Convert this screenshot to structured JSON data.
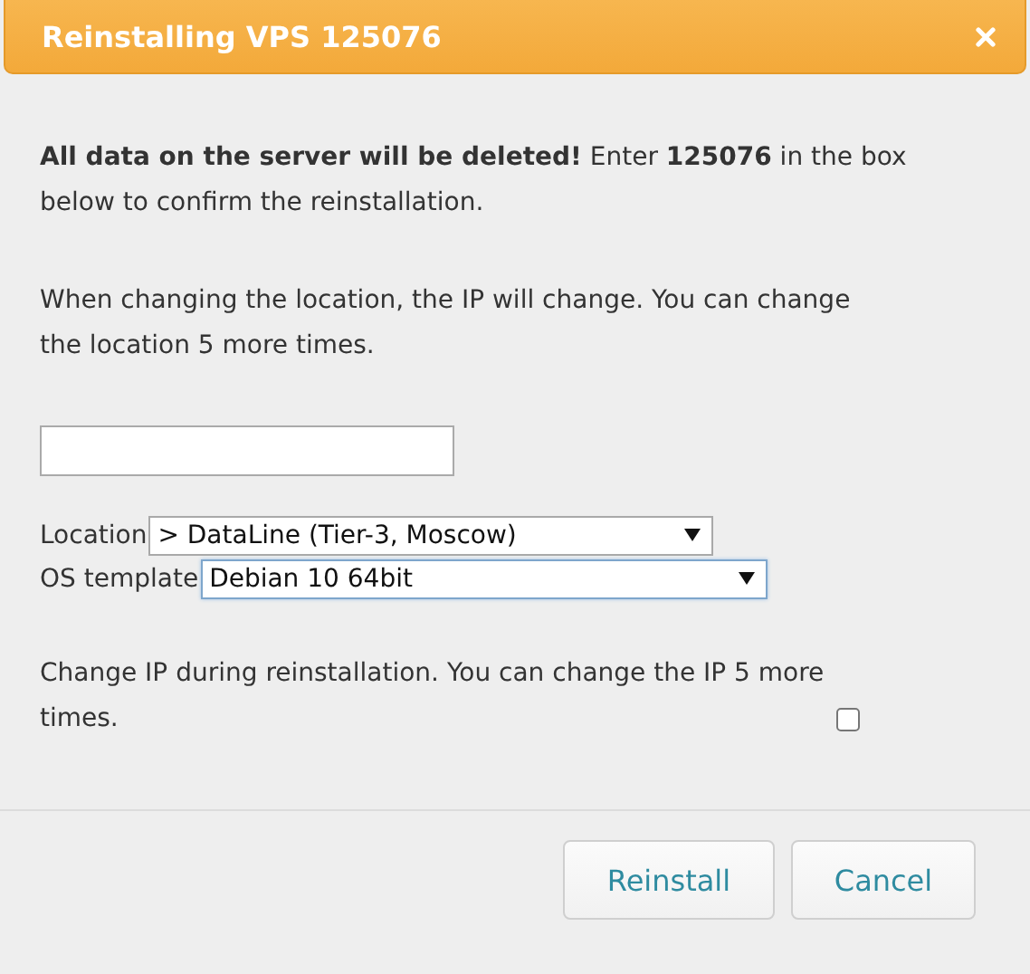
{
  "dialog": {
    "title": "Reinstalling VPS 125076"
  },
  "paragraphs": [
    "**All data on the server will be deleted!** Enter **125076** in the box below to confirm the reinstallation.",
    "When changing the location, the IP will change. You can change the location 5 more times."
  ],
  "selects": [
    {
      "label": "Location",
      "value": "> DataLine (Tier-3, Moscow)",
      "focused": false
    },
    {
      "label": "OS template",
      "value": "Debian 10 64bit",
      "focused": true
    }
  ],
  "change_ip": {
    "label": "Change IP during reinstallation. You can change the IP 5 more times.",
    "checked": false
  },
  "buttons": [
    {
      "label": "Reinstall"
    },
    {
      "label": "Cancel"
    }
  ]
}
